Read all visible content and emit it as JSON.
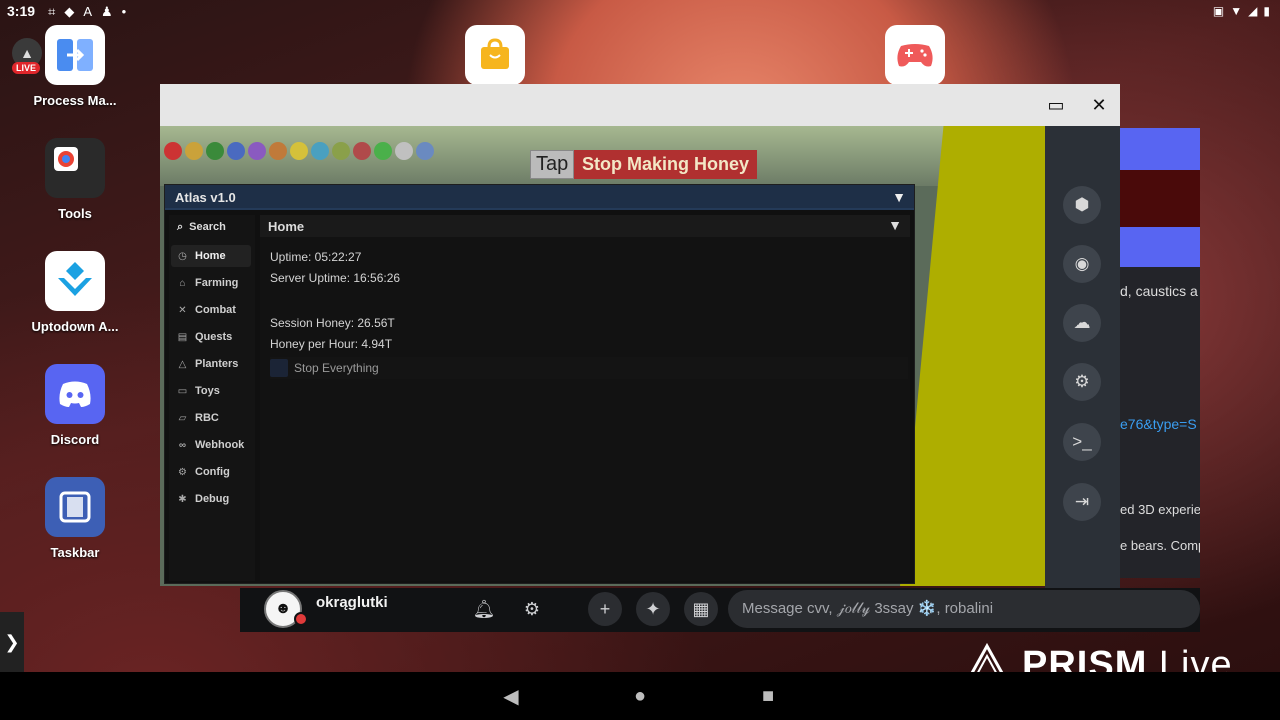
{
  "status_bar": {
    "time": "3:19"
  },
  "desktop": {
    "apps": [
      {
        "label": "Process Ma...",
        "icon": "process-manager-icon"
      },
      {
        "label": "Tools",
        "icon": "tools-folder-icon"
      },
      {
        "label": "Uptodown A...",
        "icon": "uptodown-icon"
      },
      {
        "label": "Discord",
        "icon": "discord-icon"
      },
      {
        "label": "Taskbar",
        "icon": "taskbar-icon"
      }
    ],
    "live_badge": "LIVE"
  },
  "game": {
    "tap_label": "Tap",
    "stop_making_honey": "Stop Making Honey"
  },
  "atlas": {
    "title": "Atlas v1.0",
    "search_label": "Search",
    "nav": [
      {
        "label": "Home",
        "icon": "clock-icon"
      },
      {
        "label": "Farming",
        "icon": "house-icon"
      },
      {
        "label": "Combat",
        "icon": "swords-icon"
      },
      {
        "label": "Quests",
        "icon": "scroll-icon"
      },
      {
        "label": "Planters",
        "icon": "planter-icon"
      },
      {
        "label": "Toys",
        "icon": "box-icon"
      },
      {
        "label": "RBC",
        "icon": "rbc-icon"
      },
      {
        "label": "Webhook",
        "icon": "link-icon"
      },
      {
        "label": "Config",
        "icon": "gear-icon"
      },
      {
        "label": "Debug",
        "icon": "bug-icon"
      }
    ],
    "content": {
      "header": "Home",
      "uptime": "Uptime: 05:22:27",
      "server_uptime": "Server Uptime: 16:56:26",
      "session_honey": "Session Honey: 26.56T",
      "honey_per_hour": "Honey per Hour: 4.94T",
      "stop_everything": "Stop Everything"
    }
  },
  "background_page": {
    "text1": "d, caustics a",
    "link": "e76&type=S",
    "text2": "ed 3D experie",
    "text3": "e bears. Comp"
  },
  "discord": {
    "username": "okrąglutki",
    "message_placeholder": "Message cvv, 𝒿𝑜𝓁𝓁𝓎 3ssay ❄️, robalini"
  },
  "watermark": {
    "brand": "PRISM",
    "suffix": "Live"
  },
  "colors": {
    "atlas_title": "#1e2f47",
    "discord_blurple": "#5865f2",
    "stop_honey_bg": "#b03030"
  }
}
